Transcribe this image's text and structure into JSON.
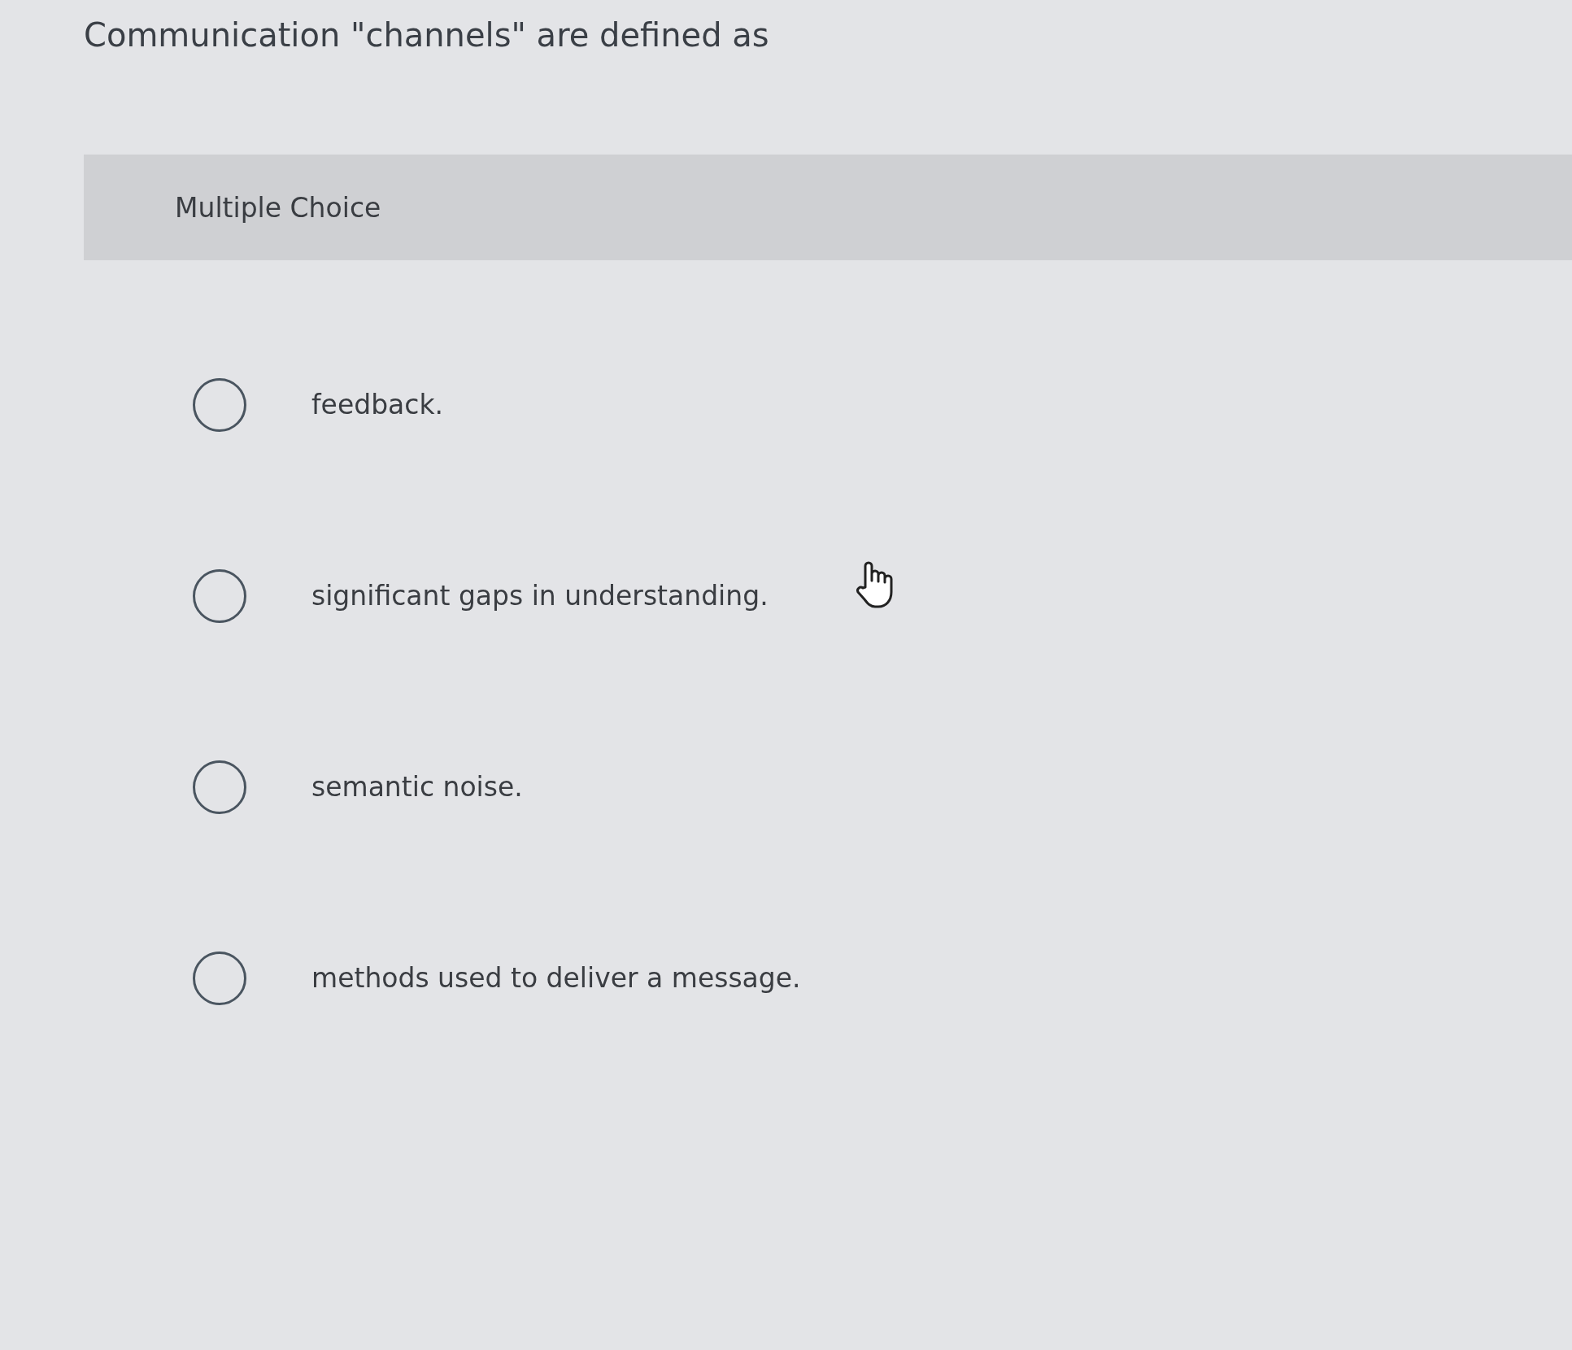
{
  "question": "Communication \"channels\" are defined as",
  "question_type": "Multiple Choice",
  "options": [
    {
      "label": "feedback.",
      "selected": false
    },
    {
      "label": "significant gaps in understanding.",
      "selected": false
    },
    {
      "label": "semantic noise.",
      "selected": false
    },
    {
      "label": "methods used to deliver a message.",
      "selected": false
    }
  ]
}
